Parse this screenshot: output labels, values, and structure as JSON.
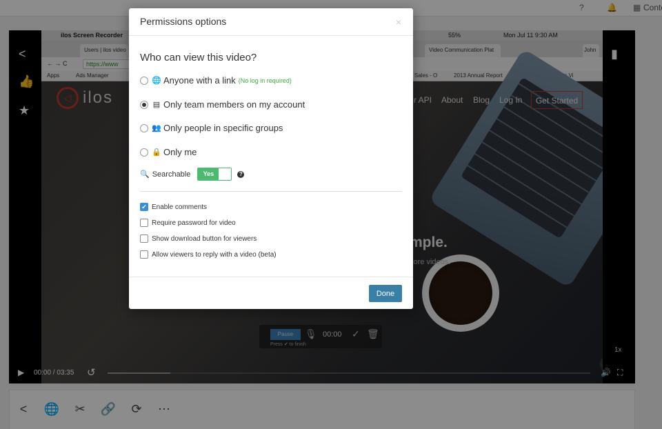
{
  "topbar": {
    "content_label": "Conte"
  },
  "screen_recording": {
    "app_name": "ilos Screen Recorder",
    "clock": "Mon Jul 11  9:30 AM",
    "battery": "55%",
    "tabs": [
      "Users | ilos video",
      "Video Communication Plat"
    ],
    "profile": "John",
    "url": "https://www",
    "bookmarks": [
      "Apps",
      "Ads Manager",
      "r Sales - O",
      "2013 Annual Report",
      "Red Company on Vi"
    ],
    "site_logo": "ilos",
    "site_nav": [
      "r API",
      "About",
      "Blog",
      "Log In"
    ],
    "get_started": "Get Started",
    "hero": "mple.",
    "hero_sub": "core videos.",
    "recorder": {
      "pause": "Pause",
      "time": "00:00",
      "hint": "Press ✔ to finish"
    }
  },
  "player": {
    "current_time": "00:00",
    "duration": "03:35",
    "progress": 0.13,
    "speed": "1x",
    "side_icons": [
      "share-icon",
      "thumbs-up-icon",
      "star-icon",
      "bookmark-icon"
    ]
  },
  "toolbar": {
    "icons": [
      "share-icon",
      "globe-icon",
      "scissors-icon",
      "link-icon",
      "refresh-icon",
      "more-icon"
    ]
  },
  "modal": {
    "title": "Permissions options",
    "close": "×",
    "question": "Who can view this video?",
    "options": [
      {
        "label": "Anyone with a link",
        "hint": "(No log in required)",
        "selected": false
      },
      {
        "label": "Only team members on my account",
        "hint": "",
        "selected": true
      },
      {
        "label": "Only people in specific groups",
        "hint": "",
        "selected": false
      },
      {
        "label": "Only me",
        "hint": "",
        "selected": false
      }
    ],
    "searchable_label": "Searchable",
    "searchable_value": "Yes",
    "help": "?",
    "checkboxes": [
      {
        "label": "Enable comments",
        "checked": true
      },
      {
        "label": "Require password for video",
        "checked": false
      },
      {
        "label": "Show download button for viewers",
        "checked": false
      },
      {
        "label": "Allow viewers to reply with a video (beta)",
        "checked": false
      }
    ],
    "done": "Done"
  },
  "colors": {
    "toggle_green": "#4cba70",
    "done_blue": "#3a7fa8",
    "hint_green": "#3aaa35",
    "checkbox_blue": "#3a8ed5"
  }
}
